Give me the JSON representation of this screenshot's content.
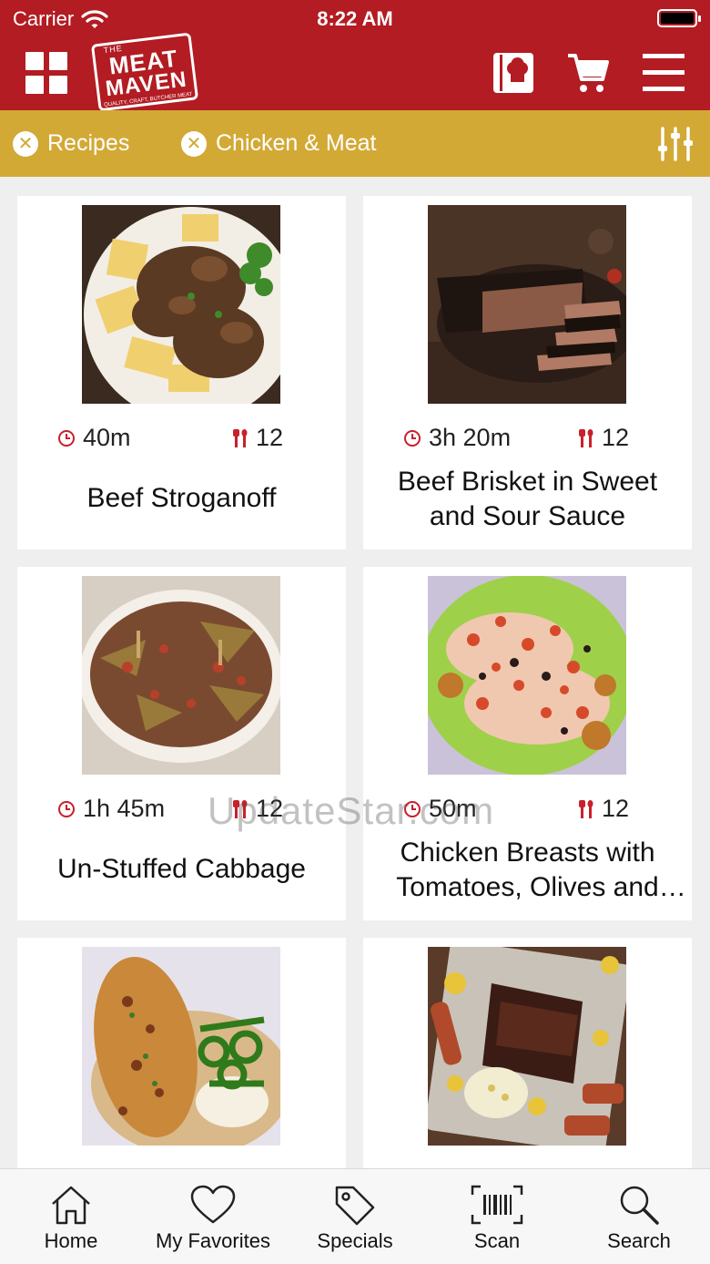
{
  "status_bar": {
    "carrier": "Carrier",
    "time": "8:22 AM"
  },
  "header": {
    "logo": {
      "line1": "THE",
      "line2": "MEAT",
      "line3": "MAVEN",
      "tagline": "QUALITY, CRAFT, BUTCHER MEAT"
    }
  },
  "filters": {
    "chips": [
      {
        "label": "Recipes"
      },
      {
        "label": "Chicken & Meat"
      }
    ]
  },
  "recipes": [
    {
      "time": "40m",
      "servings": "12",
      "title": "Beef Stroganoff"
    },
    {
      "time": "3h 20m",
      "servings": "12",
      "title": "Beef Brisket in Sweet and Sour Sauce"
    },
    {
      "time": "1h 45m",
      "servings": "12",
      "title": "Un-Stuffed Cabbage"
    },
    {
      "time": "50m",
      "servings": "12",
      "title": "Chicken Breasts with Tomatoes, Olives and Capers"
    },
    {
      "time": "",
      "servings": "",
      "title": ""
    },
    {
      "time": "",
      "servings": "",
      "title": ""
    }
  ],
  "watermark": "UpdateStar.com",
  "tabs": [
    {
      "label": "Home"
    },
    {
      "label": "My Favorites"
    },
    {
      "label": "Specials"
    },
    {
      "label": "Scan"
    },
    {
      "label": "Search"
    }
  ],
  "colors": {
    "brand_red": "#b21c22",
    "gold": "#d3a936",
    "accent_red": "#c8202c"
  }
}
